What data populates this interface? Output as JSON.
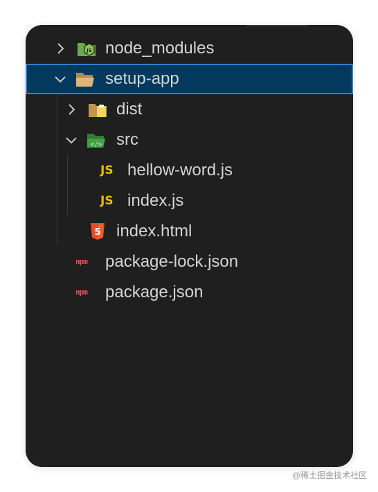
{
  "explorer": {
    "items": [
      {
        "label": "node_modules",
        "kind": "folder",
        "expanded": false,
        "icon": "nodejs-folder-icon"
      },
      {
        "label": "setup-app",
        "kind": "folder",
        "expanded": true,
        "selected": true,
        "icon": "open-folder-icon"
      },
      {
        "label": "dist",
        "kind": "folder",
        "expanded": false,
        "icon": "dist-folder-icon"
      },
      {
        "label": "src",
        "kind": "folder",
        "expanded": true,
        "icon": "src-folder-icon"
      },
      {
        "label": "hellow-word.js",
        "kind": "file",
        "icon": "javascript-file-icon",
        "icon_text": "JS"
      },
      {
        "label": "index.js",
        "kind": "file",
        "icon": "javascript-file-icon",
        "icon_text": "JS"
      },
      {
        "label": "index.html",
        "kind": "file",
        "icon": "html5-file-icon",
        "icon_text": "5"
      },
      {
        "label": "package-lock.json",
        "kind": "file",
        "icon": "npm-file-icon",
        "icon_text": "npm"
      },
      {
        "label": "package.json",
        "kind": "file",
        "icon": "npm-file-icon",
        "icon_text": "npm"
      }
    ]
  },
  "colors": {
    "panel_bg": "#1f1f1f",
    "selection_bg": "#04395e",
    "selection_border": "#2f80c8",
    "text": "#d4d4d4",
    "js_yellow": "#e6c000",
    "html_orange": "#e44d26",
    "npm_red": "#e05252",
    "node_green": "#6aa84f"
  },
  "watermark": "@稀土掘金技术社区"
}
